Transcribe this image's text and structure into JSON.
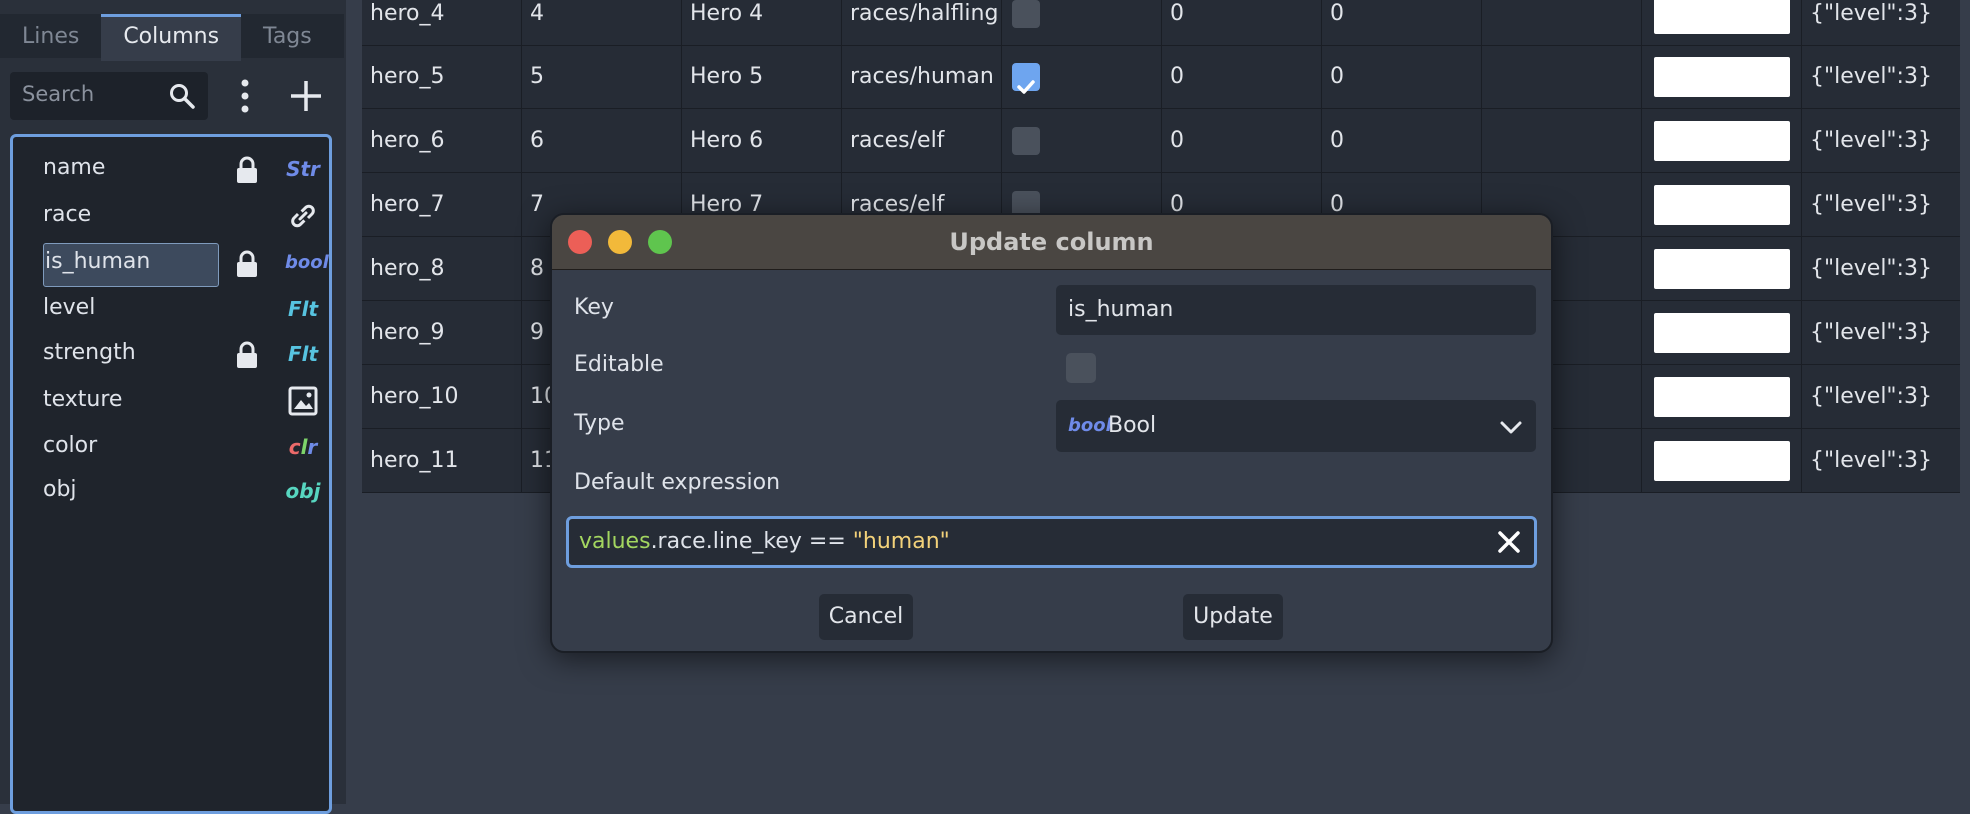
{
  "left_panel": {
    "tabs": [
      "Lines",
      "Columns",
      "Tags"
    ],
    "active_tab": "Columns",
    "search_placeholder": "Search",
    "columns": [
      {
        "label": "name",
        "type_icon": "Str",
        "locked": true
      },
      {
        "label": "race",
        "type_icon": "link",
        "locked": false
      },
      {
        "label": "is_human",
        "type_icon": "bool",
        "locked": true,
        "selected": true
      },
      {
        "label": "level",
        "type_icon": "Flt",
        "locked": false
      },
      {
        "label": "strength",
        "type_icon": "Flt",
        "locked": true
      },
      {
        "label": "texture",
        "type_icon": "image",
        "locked": false
      },
      {
        "label": "color",
        "type_icon": "clr",
        "locked": false
      },
      {
        "label": "obj",
        "type_icon": "obj",
        "locked": false
      }
    ]
  },
  "table": {
    "rows": [
      {
        "key": "hero_4",
        "id": "4",
        "name": "Hero 4",
        "race": "races/halfling",
        "is_human": false,
        "level": "0",
        "strength": "0",
        "obj": "{\"level\":3}"
      },
      {
        "key": "hero_5",
        "id": "5",
        "name": "Hero 5",
        "race": "races/human",
        "is_human": true,
        "level": "0",
        "strength": "0",
        "obj": "{\"level\":3}"
      },
      {
        "key": "hero_6",
        "id": "6",
        "name": "Hero 6",
        "race": "races/elf",
        "is_human": false,
        "level": "0",
        "strength": "0",
        "obj": "{\"level\":3}"
      },
      {
        "key": "hero_7",
        "id": "7",
        "name": "Hero 7",
        "race": "races/elf",
        "is_human": false,
        "level": "0",
        "strength": "0",
        "obj": "{\"level\":3}"
      },
      {
        "key": "hero_8",
        "id": "8",
        "name": "",
        "race": "",
        "is_human": null,
        "level": "",
        "strength": "",
        "obj": "{\"level\":3}"
      },
      {
        "key": "hero_9",
        "id": "9",
        "name": "",
        "race": "",
        "is_human": null,
        "level": "",
        "strength": "",
        "obj": "{\"level\":3}"
      },
      {
        "key": "hero_10",
        "id": "10",
        "name": "",
        "race": "",
        "is_human": null,
        "level": "",
        "strength": "",
        "obj": "{\"level\":3}"
      },
      {
        "key": "hero_11",
        "id": "11",
        "name": "",
        "race": "",
        "is_human": null,
        "level": "",
        "strength": "",
        "obj": "{\"level\":3}"
      }
    ]
  },
  "dialog": {
    "title": "Update column",
    "key_label": "Key",
    "key_value": "is_human",
    "editable_label": "Editable",
    "editable_checked": false,
    "type_label": "Type",
    "type_value": "Bool",
    "type_icon": "bool",
    "default_label": "Default expression",
    "expression": {
      "kw": "values",
      "mid": ".race.line_key == ",
      "str": "\"human\""
    },
    "cancel_label": "Cancel",
    "update_label": "Update"
  },
  "colors": {
    "accent": "#6e9ede",
    "str_icon": "#6f8be8",
    "flt_icon": "#57c3e0",
    "obj_icon": "#57d6c0",
    "close": "#ec5f57",
    "minimize": "#f2b93a",
    "maximize": "#5fc54e"
  }
}
